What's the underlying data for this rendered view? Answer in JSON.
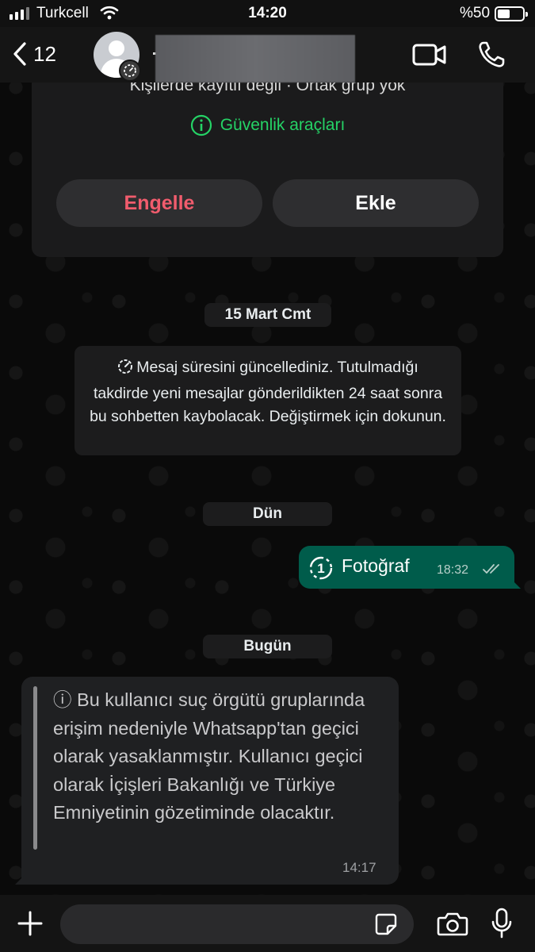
{
  "status_bar": {
    "carrier": "Turkcell",
    "time": "14:20",
    "battery_percent_label": "%50",
    "battery_level": 0.5
  },
  "header": {
    "back_count": "12"
  },
  "contact_card": {
    "info_line": "Kişilerde kayıtlı değil · Ortak grup yok",
    "safety_tools": "Güvenlik araçları",
    "block_label": "Engelle",
    "add_label": "Ekle"
  },
  "chat": {
    "date_1": "15 Mart Cmt",
    "system_message": "Mesaj süresini güncellediniz. Tutulmadığı takdirde yeni mesajlar gönderildikten 24 saat sonra bu sohbetten kaybolacak. Değiştirmek için dokunun.",
    "date_2": "Dün",
    "outgoing": {
      "text": "Fotoğraf",
      "time": "18:32"
    },
    "date_3": "Bugün",
    "incoming": {
      "text": "ⓘ Bu kullanıcı suç örgütü gruplarında erişim nedeniyle Whatsapp'tan geçici olarak yasaklanmıştır. Kullanıcı geçici olarak İçişleri Bakanlığı ve Türkiye Emniyetinin gözetiminde olacaktır.",
      "time": "14:17"
    }
  },
  "colors": {
    "accent_green": "#25d366",
    "block_red": "#f15c6d",
    "outgoing_bubble": "#005c4b",
    "incoming_bubble": "#1f2022"
  },
  "icons": [
    "signal-icon",
    "wifi-icon",
    "battery-icon",
    "back-chevron-icon",
    "avatar-icon",
    "timer-icon",
    "video-call-icon",
    "phone-icon",
    "info-icon",
    "view-once-icon",
    "double-check-icon",
    "plus-icon",
    "sticker-icon",
    "camera-icon",
    "mic-icon"
  ]
}
